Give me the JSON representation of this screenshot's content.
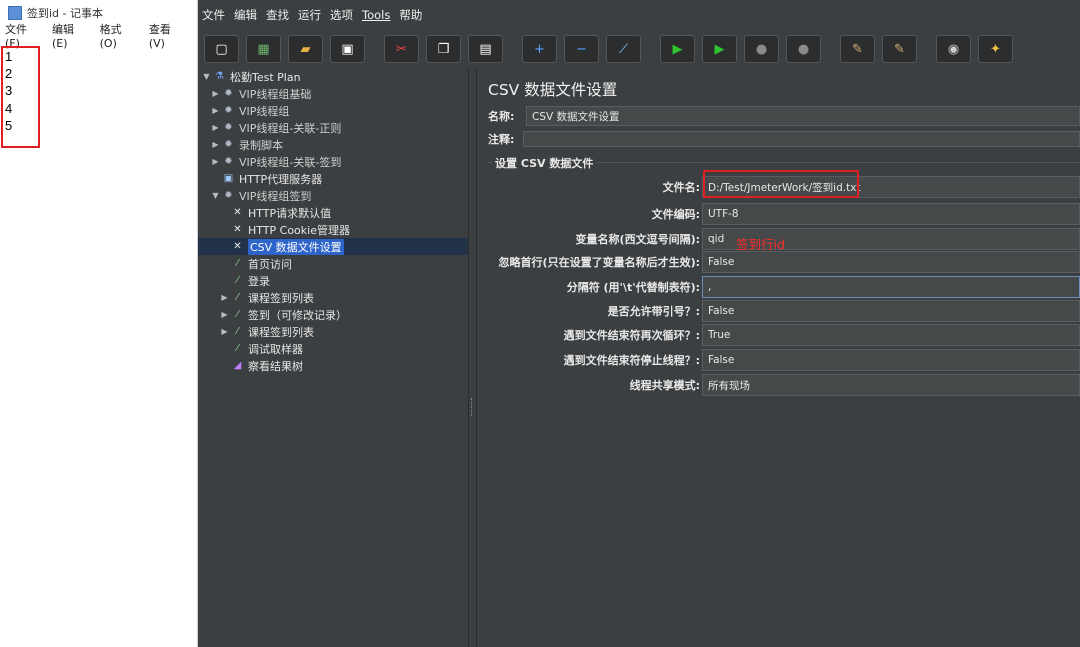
{
  "notepad": {
    "title": "签到id - 记事本",
    "menu": [
      "文件(F)",
      "编辑(E)",
      "格式(O)",
      "查看(V)"
    ],
    "lines": [
      "1",
      "2",
      "3",
      "4",
      "5"
    ]
  },
  "jmeter": {
    "menu": [
      "文件",
      "编辑",
      "查找",
      "运行",
      "选项",
      "Tools",
      "帮助"
    ],
    "toolbar": [
      {
        "icon": "new-icon",
        "glyph": "▢"
      },
      {
        "icon": "templates-icon",
        "glyph": "▦"
      },
      {
        "icon": "open-icon",
        "glyph": "▰"
      },
      {
        "icon": "save-icon",
        "glyph": "▣"
      },
      {
        "icon": "cut-icon",
        "glyph": "✂"
      },
      {
        "icon": "copy-icon",
        "glyph": "❐"
      },
      {
        "icon": "paste-icon",
        "glyph": "▤"
      },
      {
        "icon": "expand-icon",
        "glyph": "+"
      },
      {
        "icon": "collapse-icon",
        "glyph": "−"
      },
      {
        "icon": "toggle-icon",
        "glyph": "⟋"
      },
      {
        "icon": "start-icon",
        "glyph": "▶"
      },
      {
        "icon": "start-no-pause-icon",
        "glyph": "▶"
      },
      {
        "icon": "stop-icon",
        "glyph": "●"
      },
      {
        "icon": "shutdown-icon",
        "glyph": "●"
      },
      {
        "icon": "clear-icon",
        "glyph": "✎"
      },
      {
        "icon": "clear-all-icon",
        "glyph": "✎"
      },
      {
        "icon": "search-icon",
        "glyph": "◉"
      },
      {
        "icon": "reset-search-icon",
        "glyph": "✦"
      }
    ],
    "colors": {
      "accent_red": "#e02020",
      "selection": "#2f65ca",
      "start_green": "#2ec22e"
    },
    "tree": [
      {
        "label": "松勤Test Plan",
        "expander": "▼",
        "icon": "test-plan-icon",
        "glyph": "⚗",
        "depth": 0
      },
      {
        "label": "VIP线程组基础",
        "expander": "▶",
        "icon": "gear-icon",
        "glyph": "✹",
        "depth": 1
      },
      {
        "label": "VIP线程组",
        "expander": "▶",
        "icon": "gear-icon",
        "glyph": "✹",
        "depth": 1
      },
      {
        "label": "VIP线程组-关联-正则",
        "expander": "▶",
        "icon": "gear-icon",
        "glyph": "✹",
        "depth": 1
      },
      {
        "label": "录制脚本",
        "expander": "▶",
        "icon": "gear-icon",
        "glyph": "✹",
        "depth": 1
      },
      {
        "label": "VIP线程组-关联-签到",
        "expander": "▶",
        "icon": "gear-icon",
        "glyph": "✹",
        "depth": 1
      },
      {
        "label": "HTTP代理服务器",
        "expander": "",
        "icon": "proxy-icon",
        "glyph": "▣",
        "depth": 1
      },
      {
        "label": "VIP线程组签到",
        "expander": "▼",
        "icon": "gear-icon",
        "glyph": "✹",
        "depth": 1
      },
      {
        "label": "HTTP请求默认值",
        "expander": "",
        "icon": "wrench-icon",
        "glyph": "✕",
        "depth": 2
      },
      {
        "label": "HTTP Cookie管理器",
        "expander": "",
        "icon": "wrench-icon",
        "glyph": "✕",
        "depth": 2
      },
      {
        "label": "CSV 数据文件设置",
        "expander": "",
        "icon": "wrench-icon",
        "glyph": "✕",
        "depth": 2,
        "selected": true
      },
      {
        "label": "首页访问",
        "expander": "",
        "icon": "sampler-icon",
        "glyph": "⁄",
        "depth": 2
      },
      {
        "label": "登录",
        "expander": "",
        "icon": "sampler-icon",
        "glyph": "⁄",
        "depth": 2
      },
      {
        "label": "课程签到列表",
        "expander": "▶",
        "icon": "sampler-icon",
        "glyph": "⁄",
        "depth": 2
      },
      {
        "label": "签到（可修改记录）",
        "expander": "▶",
        "icon": "sampler-icon",
        "glyph": "⁄",
        "depth": 2
      },
      {
        "label": "课程签到列表",
        "expander": "▶",
        "icon": "sampler-icon",
        "glyph": "⁄",
        "depth": 2
      },
      {
        "label": "调试取样器",
        "expander": "",
        "icon": "sampler-icon",
        "glyph": "⁄",
        "depth": 2
      },
      {
        "label": "察看结果树",
        "expander": "",
        "icon": "listener-icon",
        "glyph": "◢",
        "depth": 2
      }
    ],
    "panel": {
      "title": "CSV 数据文件设置",
      "name_label": "名称:",
      "name_value": "CSV 数据文件设置",
      "comment_label": "注释:",
      "comment_value": "",
      "group_label": "设置 CSV 数据文件",
      "fields": [
        {
          "label": "文件名:",
          "value": "D:/Test/JmeterWork/签到id.txt"
        },
        {
          "label": "文件编码:",
          "value": "UTF-8"
        },
        {
          "label": "变量名称(西文逗号间隔):",
          "value": "qid"
        },
        {
          "label": "忽略首行(只在设置了变量名称后才生效):",
          "value": "False"
        },
        {
          "label": "分隔符 (用'\\t'代替制表符):",
          "value": ","
        },
        {
          "label": "是否允许带引号？:",
          "value": "False"
        },
        {
          "label": "遇到文件结束符再次循环？:",
          "value": "True"
        },
        {
          "label": "遇到文件结束符停止线程？:",
          "value": "False"
        },
        {
          "label": "线程共享模式:",
          "value": "所有现场"
        }
      ],
      "annotation": "签到行id"
    }
  }
}
